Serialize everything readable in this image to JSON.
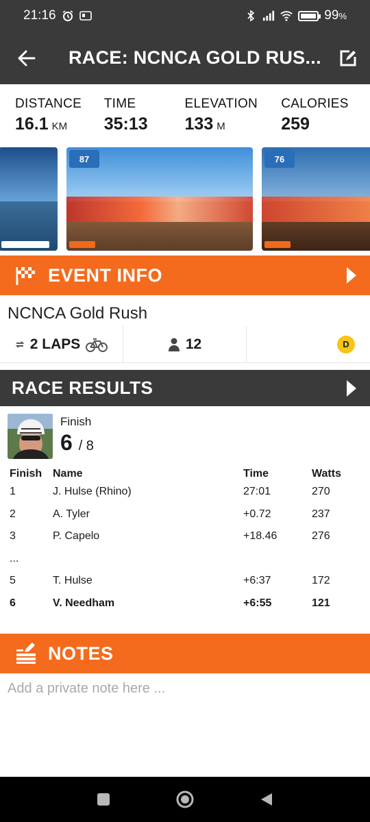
{
  "status_bar": {
    "time": "21:16",
    "battery": "99",
    "battery_suffix": "%"
  },
  "header": {
    "title": "RACE: NCNCA GOLD RUS..."
  },
  "stats": [
    {
      "label": "DISTANCE",
      "value": "16.1",
      "unit": "KM"
    },
    {
      "label": "TIME",
      "value": "35:13",
      "unit": ""
    },
    {
      "label": "ELEVATION",
      "value": "133",
      "unit": "M"
    },
    {
      "label": "CALORIES",
      "value": "259",
      "unit": ""
    }
  ],
  "thumbnails": [
    {
      "badge": ""
    },
    {
      "badge": "87"
    },
    {
      "badge": "76"
    }
  ],
  "event_info": {
    "title": "EVENT INFO",
    "name": "NCNCA Gold Rush",
    "laps": "2 LAPS",
    "riders": "12",
    "category": "D"
  },
  "race_results": {
    "title": "RACE RESULTS",
    "finish_label": "Finish",
    "finish_position": "6",
    "finish_total": "/ 8",
    "columns": [
      "Finish",
      "Name",
      "Time",
      "Watts"
    ],
    "rows": [
      {
        "pos": "1",
        "name": "J. Hulse (Rhino)",
        "time": "27:01",
        "watts": "270"
      },
      {
        "pos": "2",
        "name": "A. Tyler",
        "time": "+0.72",
        "watts": "237"
      },
      {
        "pos": "3",
        "name": "P. Capelo",
        "time": "+18.46",
        "watts": "276"
      },
      {
        "pos": "...",
        "name": "",
        "time": "",
        "watts": ""
      },
      {
        "pos": "5",
        "name": "T. Hulse",
        "time": "+6:37",
        "watts": "172"
      },
      {
        "pos": "6",
        "name": "V. Needham",
        "time": "+6:55",
        "watts": "121"
      }
    ]
  },
  "notes": {
    "title": "NOTES",
    "placeholder": "Add a private note here ..."
  },
  "colors": {
    "accent": "#f46b1e",
    "header_bg": "#3a3a3a",
    "category_badge": "#f5c518"
  }
}
